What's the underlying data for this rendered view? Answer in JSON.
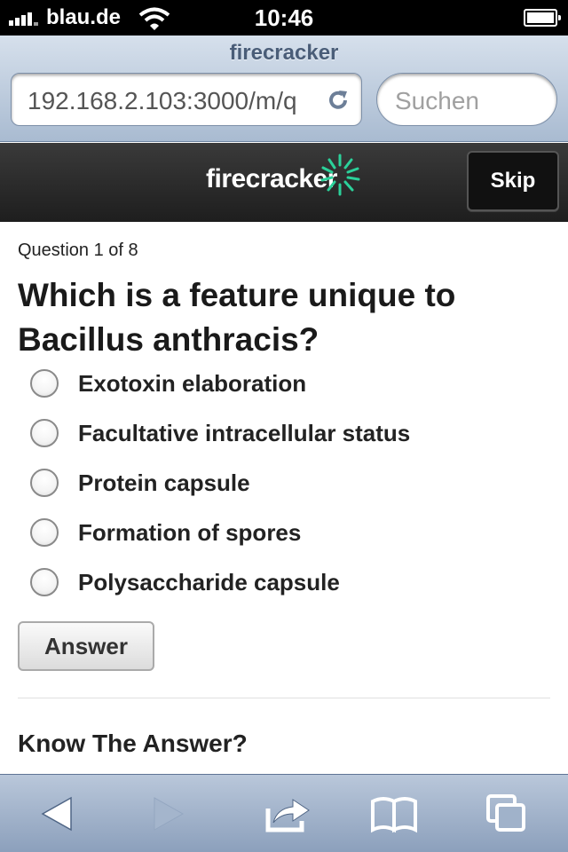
{
  "status_bar": {
    "carrier": "blau.de",
    "time": "10:46",
    "icons": [
      "signal-icon",
      "wifi-icon",
      "battery-icon"
    ]
  },
  "browser": {
    "page_title": "firecracker",
    "url": "192.168.2.103:3000/m/q",
    "search_placeholder": "Suchen"
  },
  "app_header": {
    "brand": "firecracker",
    "skip_label": "Skip",
    "accent_color": "#2bd19a"
  },
  "quiz": {
    "progress": "Question 1 of 8",
    "question": "Which is a feature unique to Bacillus anthracis?",
    "options": [
      {
        "label": "Exotoxin elaboration"
      },
      {
        "label": "Facultative intracellular status"
      },
      {
        "label": "Protein capsule"
      },
      {
        "label": "Formation of spores"
      },
      {
        "label": "Polysaccharide capsule"
      }
    ],
    "answer_label": "Answer",
    "know_heading": "Know The Answer?"
  },
  "toolbar": {
    "icons": [
      "back-icon",
      "forward-icon",
      "share-icon",
      "bookmarks-icon",
      "tabs-icon"
    ]
  }
}
